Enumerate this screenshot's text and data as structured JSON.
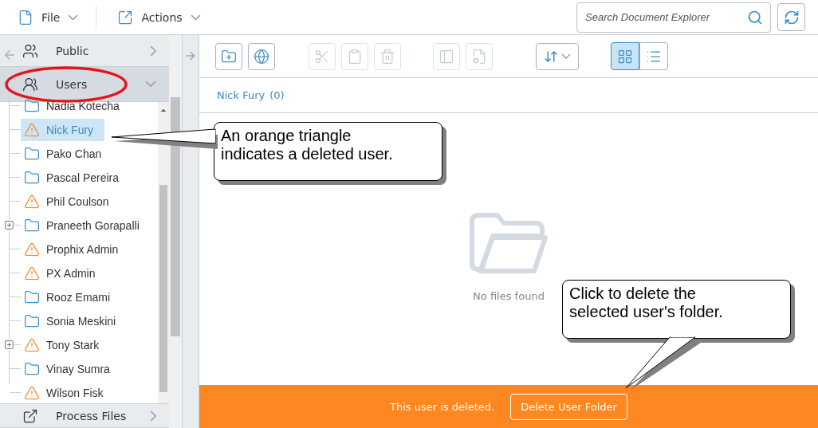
{
  "menus": [
    {
      "kind": "file",
      "label": "File"
    },
    {
      "kind": "actions",
      "label": "Actions"
    }
  ],
  "search": {
    "placeholder": "Search Document Explorer"
  },
  "sidebar": {
    "sections": [
      {
        "kind": "public",
        "label": "Public",
        "expanded": false
      },
      {
        "kind": "users",
        "label": "Users",
        "expanded": true
      }
    ],
    "tree": [
      {
        "label": "Nadia Kotecha",
        "kind": "folder",
        "expandable": false,
        "selected": false
      },
      {
        "label": "Nick Fury",
        "kind": "deleted",
        "expandable": false,
        "selected": true
      },
      {
        "label": "Pako Chan",
        "kind": "folder",
        "expandable": false,
        "selected": false
      },
      {
        "label": "Pascal Pereira",
        "kind": "folder",
        "expandable": false,
        "selected": false
      },
      {
        "label": "Phil Coulson",
        "kind": "deleted",
        "expandable": false,
        "selected": false
      },
      {
        "label": "Praneeth Gorapalli",
        "kind": "folder",
        "expandable": true,
        "selected": false
      },
      {
        "label": "Prophix Admin",
        "kind": "deleted",
        "expandable": false,
        "selected": false
      },
      {
        "label": "PX Admin",
        "kind": "deleted",
        "expandable": false,
        "selected": false
      },
      {
        "label": "Rooz Emami",
        "kind": "folder",
        "expandable": false,
        "selected": false
      },
      {
        "label": "Sonia Meskini",
        "kind": "folder",
        "expandable": false,
        "selected": false
      },
      {
        "label": "Tony Stark",
        "kind": "deleted",
        "expandable": true,
        "selected": false
      },
      {
        "label": "Vinay Sumra",
        "kind": "folder",
        "expandable": false,
        "selected": false
      },
      {
        "label": "Wilson Fisk",
        "kind": "deleted",
        "expandable": false,
        "selected": false
      }
    ],
    "bottom_section": {
      "kind": "process",
      "label": "Process Files",
      "expanded": false
    }
  },
  "toolbar": {
    "groups": [
      [
        {
          "kind": "new-folder",
          "disabled": false
        },
        {
          "kind": "web-link",
          "disabled": false
        }
      ],
      [
        {
          "kind": "cut",
          "disabled": true
        },
        {
          "kind": "paste",
          "disabled": true
        },
        {
          "kind": "delete",
          "disabled": true
        }
      ],
      [
        {
          "kind": "rename",
          "disabled": true
        },
        {
          "kind": "properties",
          "disabled": true
        }
      ]
    ],
    "views": [
      {
        "kind": "grid",
        "selected": true
      },
      {
        "kind": "list",
        "selected": false
      }
    ]
  },
  "breadcrumb": {
    "label": "Nick Fury",
    "count": "(0)"
  },
  "empty_message": "No files found",
  "banner": {
    "message": "This user is deleted.",
    "button": "Delete User Folder"
  },
  "callouts": [
    {
      "text": "An orange triangle indicates a deleted user."
    },
    {
      "text": "Click to delete the selected user's folder."
    }
  ]
}
